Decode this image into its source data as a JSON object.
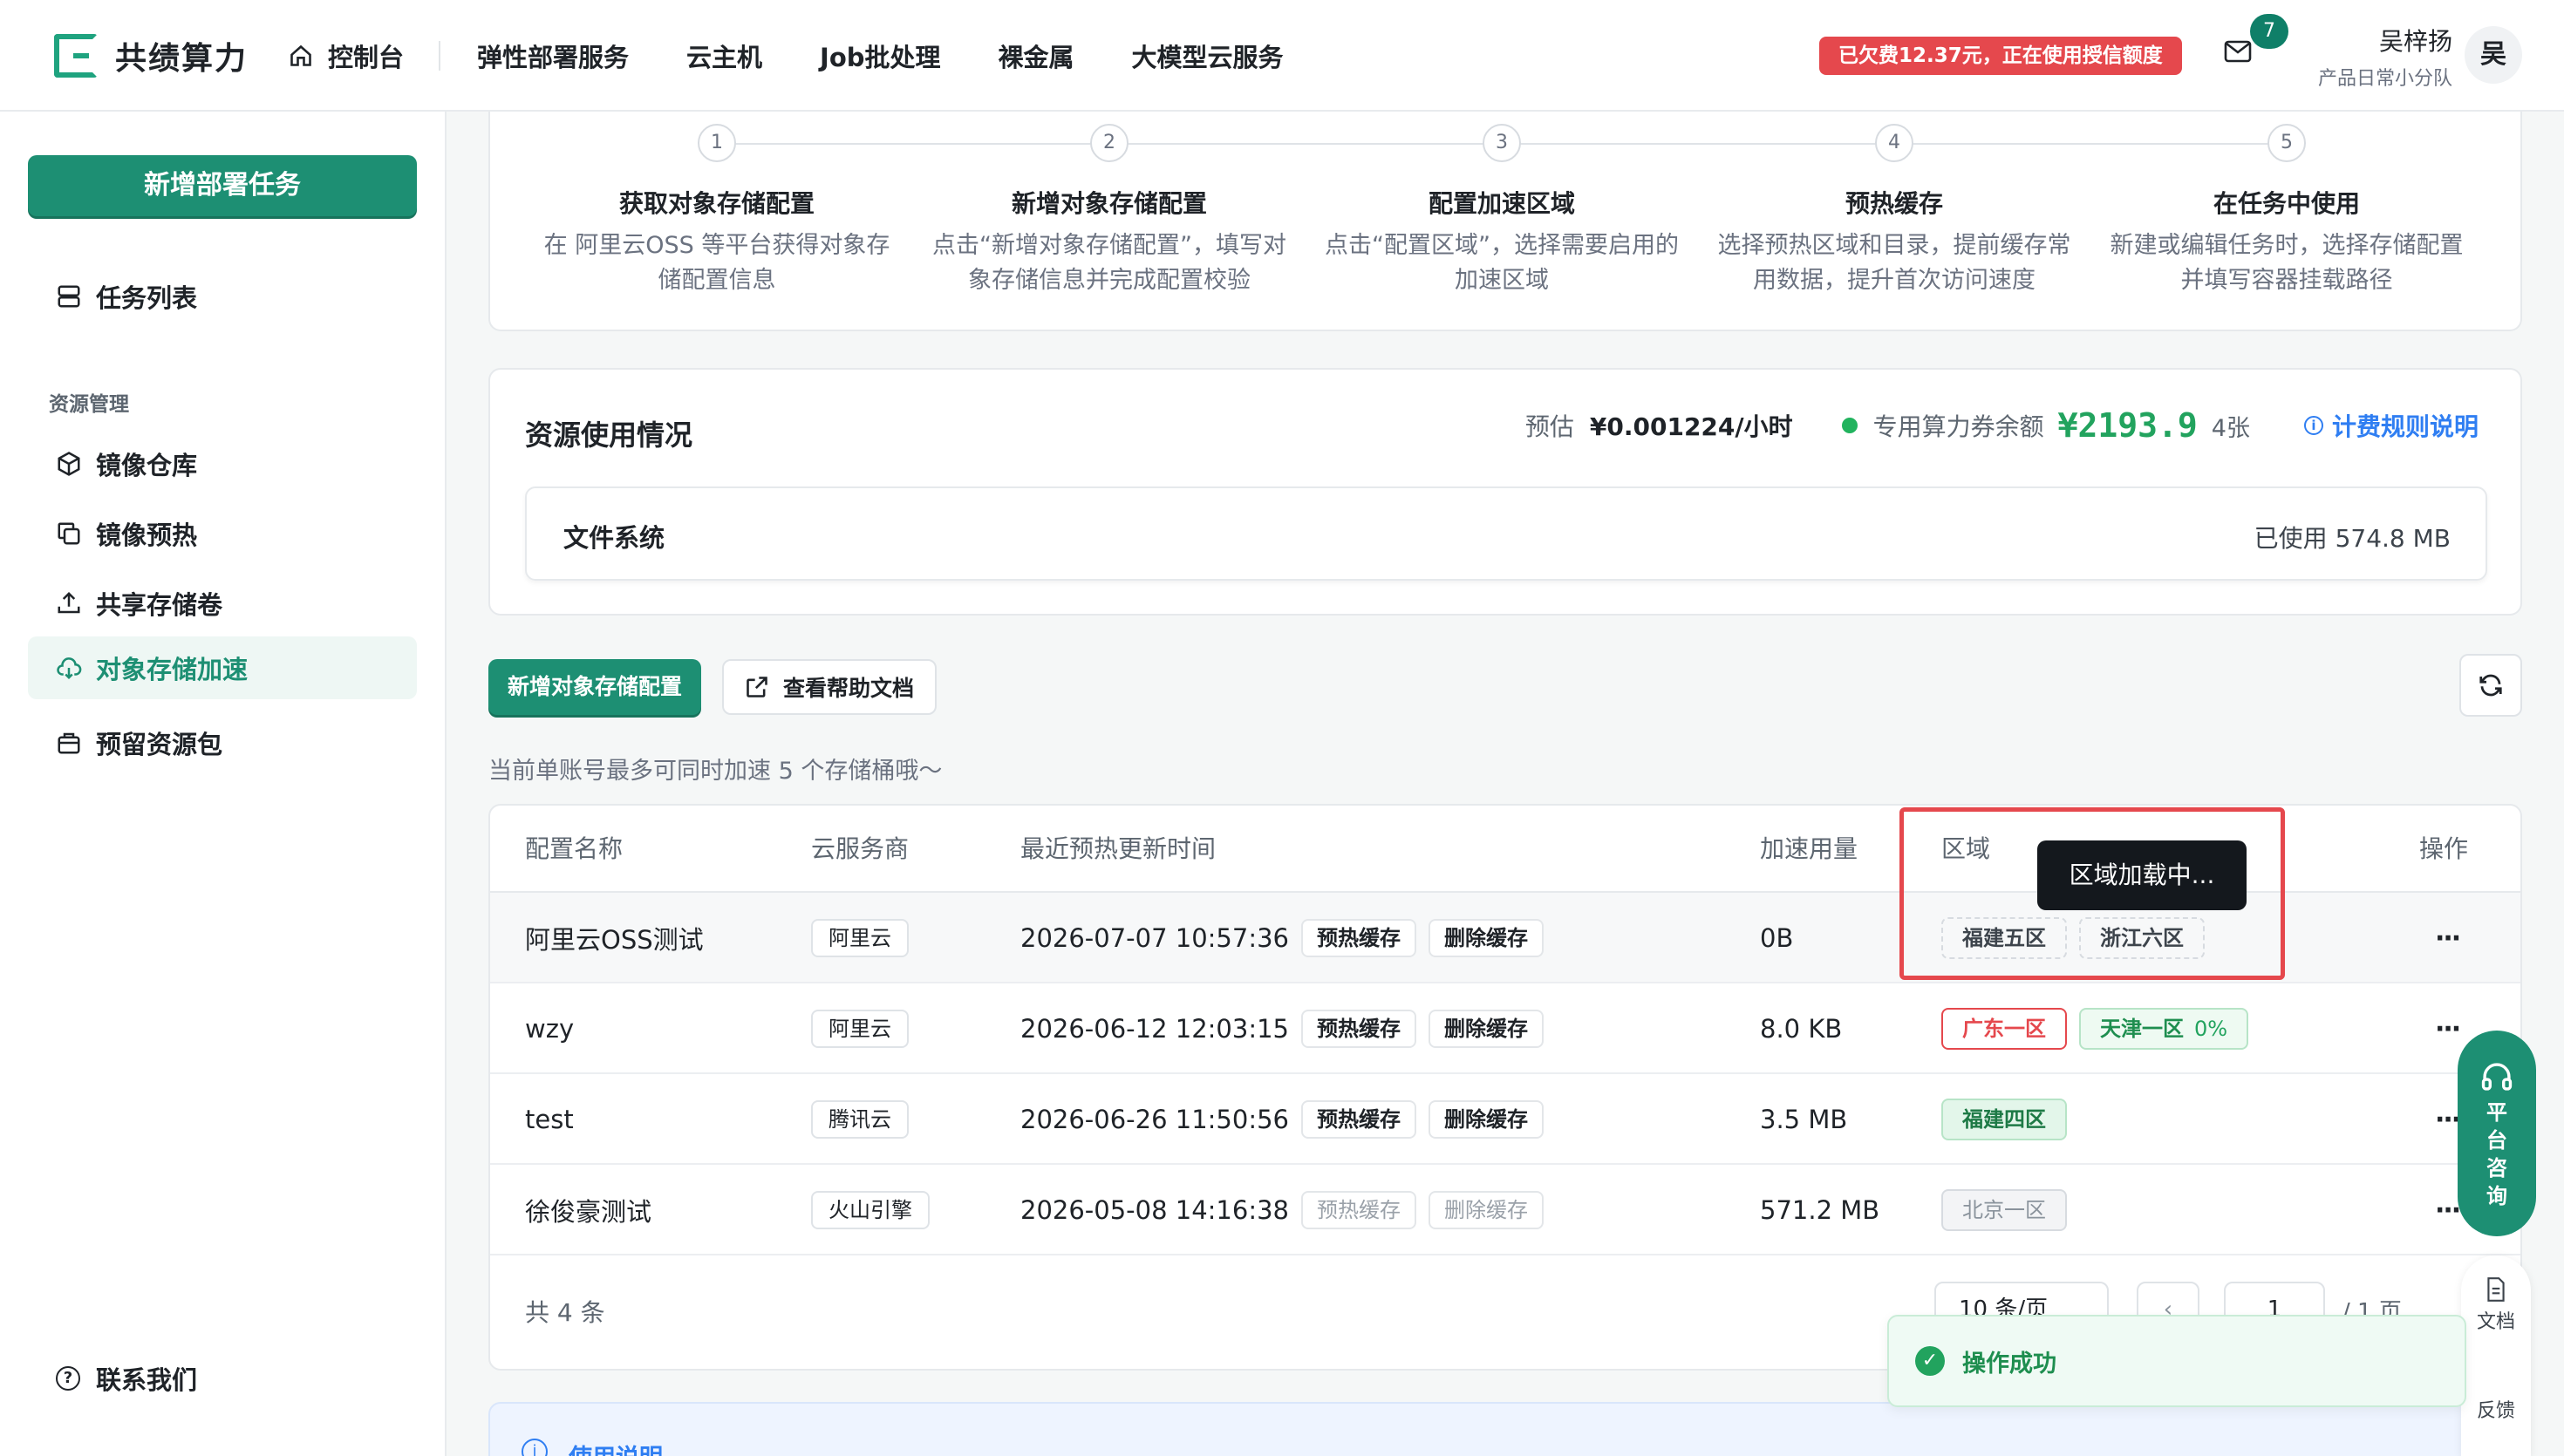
{
  "brand": {
    "name": "共绩算力"
  },
  "nav": {
    "console": "控制台",
    "items": [
      "弹性部署服务",
      "云主机",
      "Job批处理",
      "裸金属",
      "大模型云服务"
    ]
  },
  "header": {
    "arrears": "已欠费12.37元，正在使用授信额度",
    "mail_count": "7",
    "user_name": "吴梓扬",
    "user_team": "产品日常小分队",
    "avatar": "吴"
  },
  "sidebar": {
    "new_task": "新增部署任务",
    "task_list": "任务列表",
    "group_label": "资源管理",
    "items": [
      {
        "label": "镜像仓库",
        "active": false
      },
      {
        "label": "镜像预热",
        "active": false
      },
      {
        "label": "共享存储卷",
        "active": false
      },
      {
        "label": "对象存储加速",
        "active": true
      },
      {
        "label": "预留资源包",
        "active": false
      }
    ],
    "contact": "联系我们"
  },
  "steps": [
    {
      "num": "1",
      "title": "获取对象存储配置",
      "desc": "在 阿里云OSS 等平台获得对象存储配置信息"
    },
    {
      "num": "2",
      "title": "新增对象存储配置",
      "desc": "点击“新增对象存储配置”，填写对象存储信息并完成配置校验"
    },
    {
      "num": "3",
      "title": "配置加速区域",
      "desc": "点击“配置区域”，选择需要启用的加速区域"
    },
    {
      "num": "4",
      "title": "预热缓存",
      "desc": "选择预热区域和目录，提前缓存常用数据，提升首次访问速度"
    },
    {
      "num": "5",
      "title": "在任务中使用",
      "desc": "新建或编辑任务时，选择存储配置并填写容器挂载路径"
    }
  ],
  "resource": {
    "title": "资源使用情况",
    "est_label": "预估",
    "est_value": "¥0.001224/小时",
    "coupon_label": "专用算力券余额",
    "coupon_value": "¥2193.9",
    "coupon_count": "4张",
    "billing_link": "计费规则说明",
    "fs_label": "文件系统",
    "fs_used": "已使用 574.8 MB"
  },
  "toolbar": {
    "add_config": "新增对象存储配置",
    "help_doc": "查看帮助文档",
    "hint": "当前单账号最多可同时加速 5 个存储桶哦～"
  },
  "table": {
    "headers": [
      "配置名称",
      "云服务商",
      "最近预热更新时间",
      "加速用量",
      "区域",
      "操作"
    ],
    "rows": [
      {
        "name": "阿里云OSS测试",
        "provider": "阿里云",
        "time": "2026-07-07 10:57:36",
        "usage": "0B",
        "regions": [
          {
            "label": "福建五区",
            "style": "loading"
          },
          {
            "label": "浙江六区",
            "style": "loading"
          }
        ],
        "disabled": false
      },
      {
        "name": "wzy",
        "provider": "阿里云",
        "time": "2026-06-12 12:03:15",
        "usage": "8.0 KB",
        "regions": [
          {
            "label": "广东一区",
            "style": "red"
          },
          {
            "label": "天津一区",
            "style": "green",
            "pct": "0%"
          }
        ],
        "disabled": false
      },
      {
        "name": "test",
        "provider": "腾讯云",
        "time": "2026-06-26 11:50:56",
        "usage": "3.5 MB",
        "regions": [
          {
            "label": "福建四区",
            "style": "green-fill"
          }
        ],
        "disabled": false
      },
      {
        "name": "徐俊豪测试",
        "provider": "火山引擎",
        "time": "2026-05-08 14:16:38",
        "usage": "571.2 MB",
        "regions": [
          {
            "label": "北京一区",
            "style": "gray"
          }
        ],
        "disabled": true
      }
    ],
    "preheat_label": "预热缓存",
    "delete_label": "删除缓存",
    "more": "···",
    "total": "共 4 条",
    "page_size": "10 条/页",
    "page_prev": "‹",
    "page_input": "1",
    "page_total": "/ 1 页",
    "page_next": "›"
  },
  "tooltip": "区域加载中...",
  "consult": {
    "label": "平台咨询"
  },
  "float": {
    "doc": "文档",
    "feedback": "反馈"
  },
  "toast": "操作成功",
  "usage_note": {
    "title": "使用说明"
  }
}
